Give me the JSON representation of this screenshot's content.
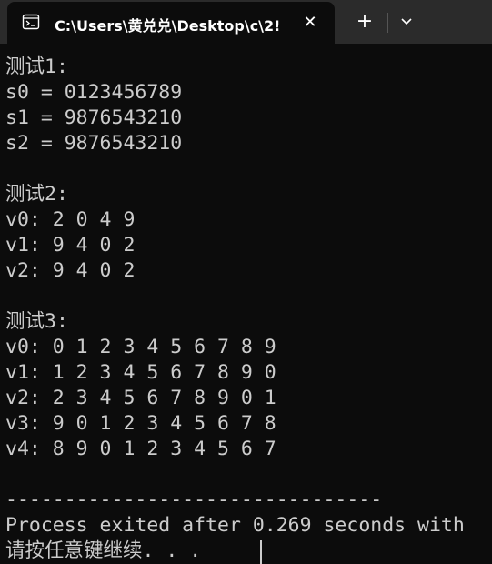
{
  "window": {
    "tab_title": "C:\\Users\\黄兑兑\\Desktop\\c\\2!",
    "close_symbol": "✕",
    "new_tab_symbol": "+",
    "icon": "terminal-icon"
  },
  "console": {
    "lines": [
      "测试1:",
      "s0 = 0123456789",
      "s1 = 9876543210",
      "s2 = 9876543210",
      "",
      "测试2:",
      "v0: 2 0 4 9",
      "v1: 9 4 0 2",
      "v2: 9 4 0 2",
      "",
      "测试3:",
      "v0: 0 1 2 3 4 5 6 7 8 9",
      "v1: 1 2 3 4 5 6 7 8 9 0",
      "v2: 2 3 4 5 6 7 8 9 0 1",
      "v3: 9 0 1 2 3 4 5 6 7 8",
      "v4: 8 9 0 1 2 3 4 5 6 7",
      "",
      "--------------------------------",
      "Process exited after 0.269 seconds with",
      "请按任意键继续. . ."
    ]
  }
}
